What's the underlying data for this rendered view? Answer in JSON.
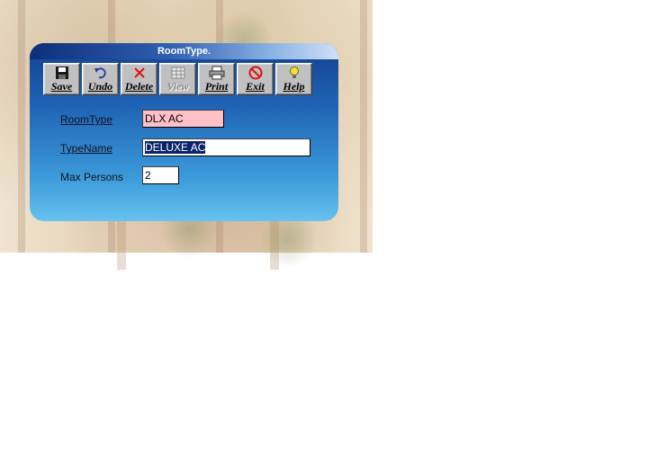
{
  "window": {
    "title": "RoomType."
  },
  "toolbar": {
    "buttons": [
      {
        "label": "Save",
        "icon": "floppy-disk-icon",
        "enabled": true
      },
      {
        "label": "Undo",
        "icon": "undo-arrow-icon",
        "enabled": true
      },
      {
        "label": "Delete",
        "icon": "delete-x-icon",
        "enabled": true
      },
      {
        "label": "View",
        "icon": "table-grid-icon",
        "enabled": false
      },
      {
        "label": "Print",
        "icon": "printer-icon",
        "enabled": true
      },
      {
        "label": "Exit",
        "icon": "no-entry-icon",
        "enabled": true
      },
      {
        "label": "Help",
        "icon": "help-bulb-icon",
        "enabled": true
      }
    ]
  },
  "form": {
    "room_type": {
      "label": "RoomType",
      "value": "DLX AC"
    },
    "type_name": {
      "label": "TypeName",
      "value": "DELUXE AC"
    },
    "max_persons": {
      "label": "Max Persons",
      "value": "2"
    }
  },
  "colors": {
    "window_top": "#13408f",
    "window_bottom": "#67c2ef",
    "roomtype_field_bg": "#ffc0c8",
    "selection_bg": "#0a246a"
  }
}
